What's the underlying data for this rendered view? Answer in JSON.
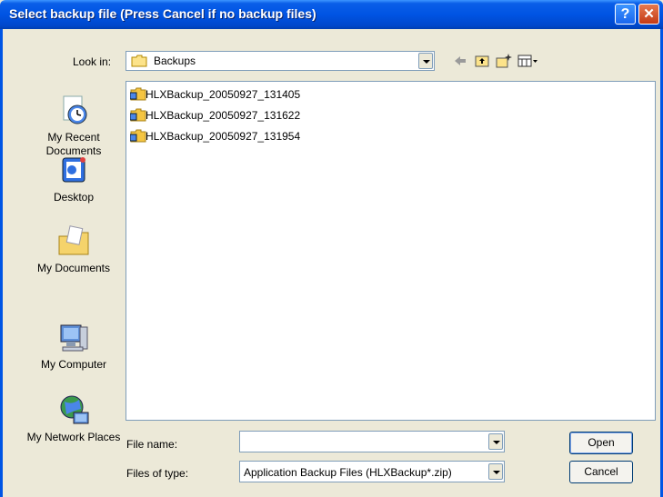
{
  "window": {
    "title": "Select backup file (Press Cancel if no backup files)",
    "help_label": "?",
    "close_label": "✕"
  },
  "lookin": {
    "label": "Look in:",
    "value": "Backups"
  },
  "places": [
    {
      "label": "My Recent Documents"
    },
    {
      "label": "Desktop"
    },
    {
      "label": "My Documents"
    },
    {
      "label": "My Computer"
    },
    {
      "label": "My Network Places"
    }
  ],
  "files": [
    {
      "name": "HLXBackup_20050927_131405"
    },
    {
      "name": "HLXBackup_20050927_131622"
    },
    {
      "name": "HLXBackup_20050927_131954"
    }
  ],
  "filename": {
    "label": "File name:",
    "value": ""
  },
  "filetype": {
    "label": "Files of type:",
    "value": "Application Backup Files (HLXBackup*.zip)"
  },
  "buttons": {
    "open": "Open",
    "cancel": "Cancel"
  }
}
